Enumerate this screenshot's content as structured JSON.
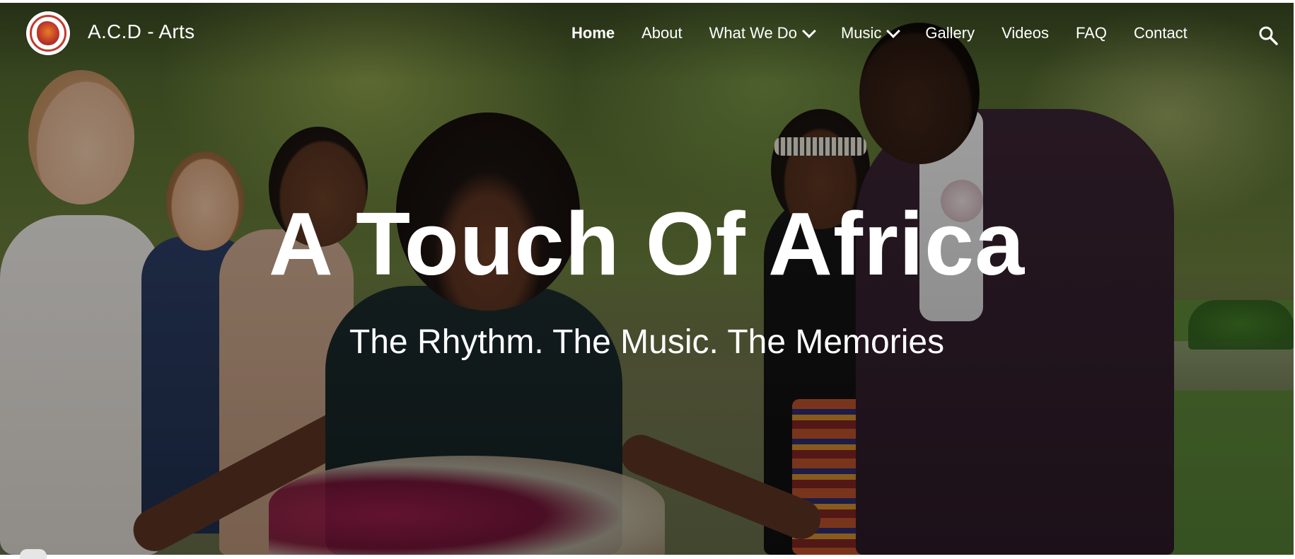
{
  "site": {
    "title": "A.C.D - Arts"
  },
  "nav": {
    "items": [
      {
        "label": "Home",
        "active": true,
        "dropdown": false
      },
      {
        "label": "About",
        "active": false,
        "dropdown": false
      },
      {
        "label": "What We Do",
        "active": false,
        "dropdown": true
      },
      {
        "label": "Music",
        "active": false,
        "dropdown": true
      },
      {
        "label": "Gallery",
        "active": false,
        "dropdown": false
      },
      {
        "label": "Videos",
        "active": false,
        "dropdown": false
      },
      {
        "label": "FAQ",
        "active": false,
        "dropdown": false
      },
      {
        "label": "Contact",
        "active": false,
        "dropdown": false
      }
    ],
    "search_icon": "search-icon"
  },
  "hero": {
    "title": "A Touch Of Africa",
    "tagline": "The Rhythm. The Music. The Memories"
  },
  "colors": {
    "text": "#ffffff",
    "logo_accent": "#c0392b"
  }
}
